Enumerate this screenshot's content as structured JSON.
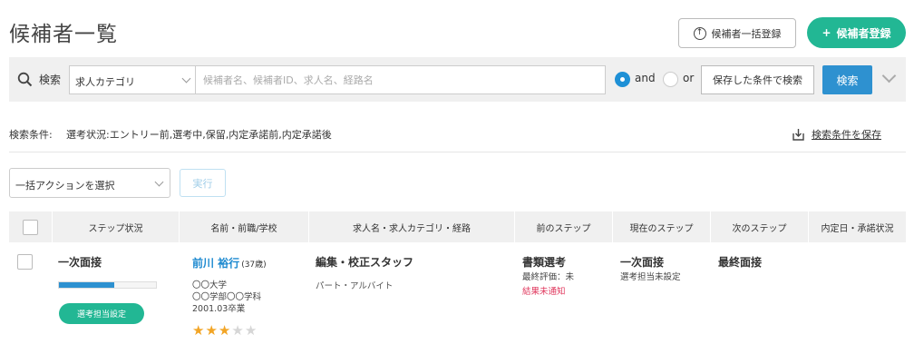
{
  "header": {
    "title": "候補者一覧",
    "bulk_register_label": "候補者一括登録",
    "register_label": "候補者登録",
    "register_icon": "+"
  },
  "search": {
    "label": "検索",
    "category_value": "求人カテゴリ",
    "keyword_placeholder": "候補者名、候補者ID、求人名、経路名",
    "and_label": "and",
    "or_label": "or",
    "selected_mode": "and",
    "saved_conditions_label": "保存した条件で検索",
    "search_button_label": "検索"
  },
  "conditions": {
    "label": "検索条件:",
    "value": "選考状況:エントリー前,選考中,保留,内定承諾前,内定承諾後",
    "save_label": "検索条件を保存"
  },
  "bulk_action": {
    "select_value": "一括アクションを選択",
    "execute_label": "実行"
  },
  "table": {
    "headers": [
      "ステップ状況",
      "名前・前職/学校",
      "求人名・求人カテゴリ・経路",
      "前のステップ",
      "現在のステップ",
      "次のステップ",
      "内定日・承諾状況"
    ],
    "rows": [
      {
        "step_status": "一次面接",
        "progress": 0.57,
        "assign_label": "選考担当設定",
        "name": "前川 裕行",
        "age": "(37歳)",
        "school_1": "〇〇大学",
        "school_2": "〇〇学部〇〇学科",
        "graduation": "2001.03卒業",
        "rating": 3,
        "rating_max": 5,
        "job_title": "編集・校正スタッフ",
        "job_type": "パート・アルバイト",
        "prev_step": "書類選考",
        "prev_eval": "最終評価：未",
        "prev_notify": "結果未通知",
        "current_step": "一次面接",
        "current_sub": "選考担当未設定",
        "next_step": "最終面接",
        "offer_status": ""
      }
    ]
  },
  "colors": {
    "accent_green": "#22b794",
    "accent_blue": "#2e91d0",
    "link_blue": "#1e8ad0",
    "alert_red": "#e0385e",
    "star_on": "#f2a526"
  }
}
